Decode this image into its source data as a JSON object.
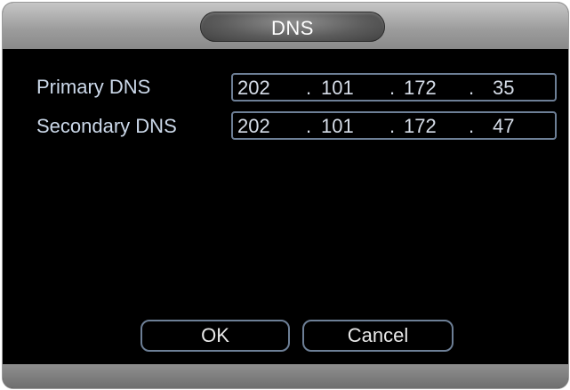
{
  "dialog": {
    "title": "DNS"
  },
  "fields": {
    "primary": {
      "label": "Primary DNS",
      "octets": [
        "202",
        "101",
        "172",
        "35"
      ]
    },
    "secondary": {
      "label": "Secondary DNS",
      "octets": [
        "202",
        "101",
        "172",
        "47"
      ]
    },
    "separator": "."
  },
  "buttons": {
    "ok_label": "OK",
    "cancel_label": "Cancel"
  },
  "colors": {
    "background": "#000000",
    "label_text": "#ccd9ea",
    "field_border": "#6d7f96",
    "title_bar": "#a4a4a4"
  }
}
